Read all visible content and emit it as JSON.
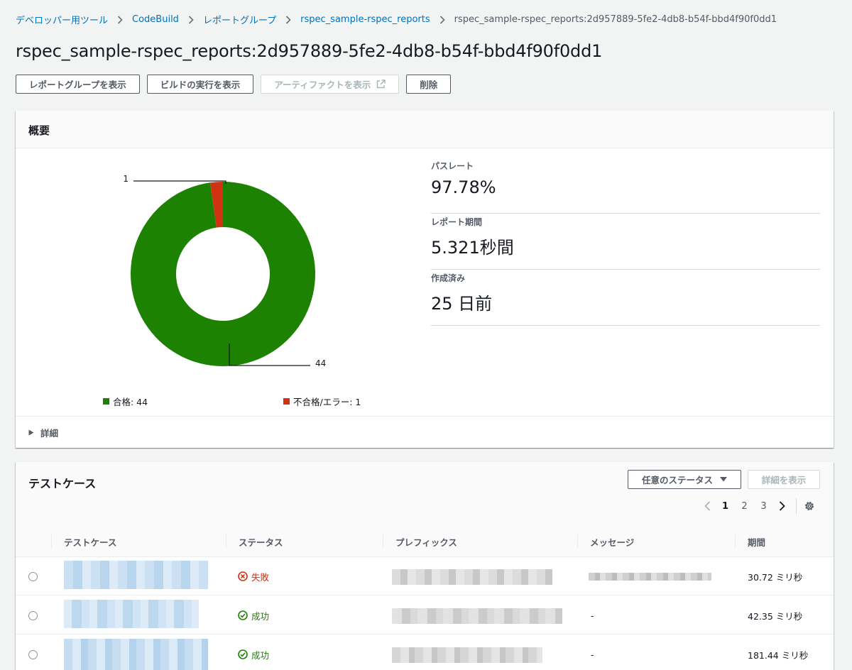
{
  "breadcrumb": {
    "items": [
      "デベロッパー用ツール",
      "CodeBuild",
      "レポートグループ",
      "rspec_sample-rspec_reports"
    ],
    "current": "rspec_sample-rspec_reports:2d957889-5fe2-4db8-b54f-bbd4f90f0dd1"
  },
  "page_title": "rspec_sample-rspec_reports:2d957889-5fe2-4db8-b54f-bbd4f90f0dd1",
  "actions": {
    "view_report_group": "レポートグループを表示",
    "view_build_run": "ビルドの実行を表示",
    "view_artifacts": "アーティファクトを表示",
    "delete": "削除"
  },
  "overview": {
    "title": "概要",
    "chart": {
      "pass_label_value": "44",
      "fail_label_value": "1",
      "legend_pass": "合格: 44",
      "legend_fail": "不合格/エラー: 1",
      "pass_color": "#1d8102",
      "fail_color": "#d13212"
    },
    "stats": [
      {
        "label": "パスレート",
        "value": "97.78%"
      },
      {
        "label": "レポート期間",
        "value": "5.321秒間"
      },
      {
        "label": "作成済み",
        "value": "25 日前"
      }
    ],
    "details_toggle": "詳細"
  },
  "chart_data": {
    "type": "pie",
    "categories": [
      "合格",
      "不合格/エラー"
    ],
    "values": [
      44,
      1
    ],
    "colors": [
      "#1d8102",
      "#d13212"
    ],
    "donut": true,
    "legend_position": "bottom"
  },
  "testcases": {
    "title": "テストケース",
    "status_filter": "任意のステータス",
    "details_button": "詳細を表示",
    "pages": [
      "1",
      "2",
      "3"
    ],
    "current_page": "1",
    "columns": [
      "テストケース",
      "ステータス",
      "プレフィックス",
      "メッセージ",
      "期間"
    ],
    "rows": [
      {
        "status": "失敗",
        "status_type": "fail",
        "message": "",
        "duration": "30.72 ミリ秒"
      },
      {
        "status": "成功",
        "status_type": "pass",
        "message": "-",
        "duration": "42.35 ミリ秒"
      },
      {
        "status": "成功",
        "status_type": "pass",
        "message": "-",
        "duration": "181.44 ミリ秒"
      }
    ]
  }
}
